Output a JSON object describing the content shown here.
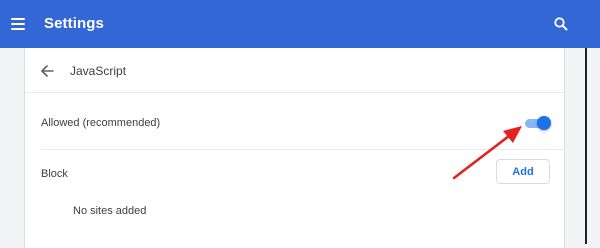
{
  "colors": {
    "accent": "#3367d6",
    "toggle_on": "#1a73e8",
    "annotation_arrow": "#e5201f"
  },
  "header": {
    "menu_icon": "hamburger-menu-icon",
    "title": "Settings",
    "search_icon": "search-icon"
  },
  "page": {
    "back_icon": "arrow-back-icon",
    "title": "JavaScript"
  },
  "allowed": {
    "label": "Allowed (recommended)",
    "toggle_state": "on"
  },
  "block": {
    "label": "Block",
    "add_label": "Add",
    "empty_text": "No sites added"
  },
  "annotation": {
    "icon": "red-arrow-pointing-to-toggle"
  }
}
